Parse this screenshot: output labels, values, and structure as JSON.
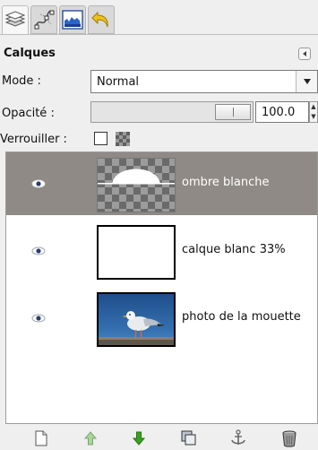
{
  "panel": {
    "title": "Calques",
    "tabs": [
      "layers-icon",
      "paths-icon",
      "histogram-icon",
      "undo-history-icon"
    ]
  },
  "mode": {
    "label": "Mode :",
    "value": "Normal"
  },
  "opacity": {
    "label": "Opacité :",
    "value": "100.0",
    "level": 1.0
  },
  "lock": {
    "label": "Verrouiller :"
  },
  "layers": [
    {
      "name": "ombre blanche",
      "visible": true,
      "selected": true,
      "thumb": "checker-with-white-arc"
    },
    {
      "name": "calque blanc 33%",
      "visible": true,
      "selected": false,
      "thumb": "white"
    },
    {
      "name": "photo de la mouette",
      "visible": true,
      "selected": false,
      "thumb": "seagull-photo"
    }
  ],
  "toolbar": [
    "new-layer-icon",
    "raise-layer-icon",
    "lower-layer-icon",
    "duplicate-layer-icon",
    "anchor-layer-icon",
    "delete-layer-icon"
  ],
  "colors": {
    "selected_row": "#8f8a86",
    "arrow_green": "#3aa21f",
    "tab_blue": "#2c64c6"
  }
}
